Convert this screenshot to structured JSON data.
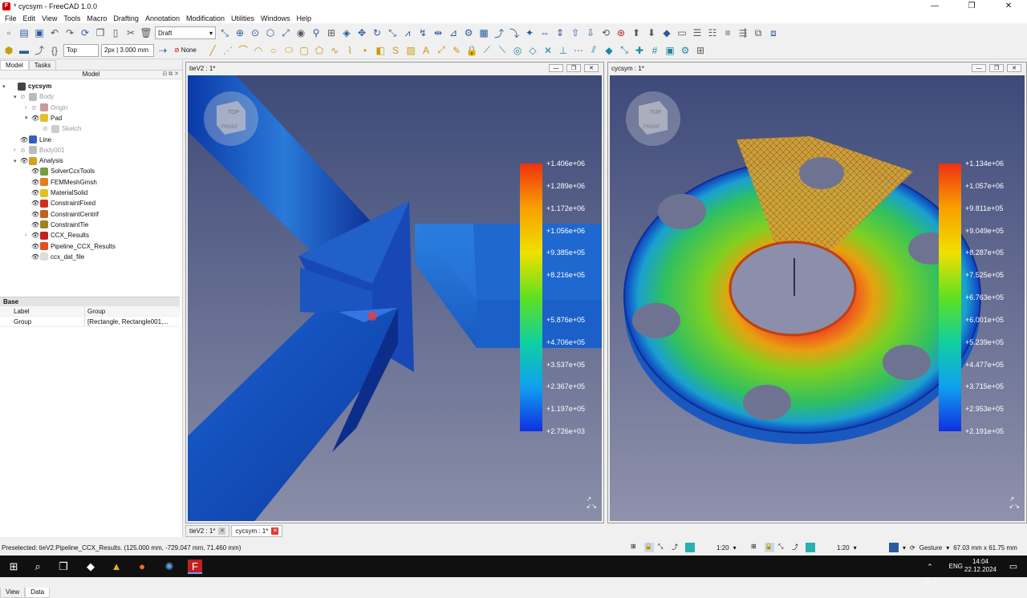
{
  "window": {
    "title": "* cycsym - FreeCAD 1.0.0",
    "controls": [
      "—",
      "❐",
      "✕"
    ]
  },
  "menu": [
    "File",
    "Edit",
    "View",
    "Tools",
    "Macro",
    "Drafting",
    "Annotation",
    "Modification",
    "Utilities",
    "Windows",
    "Help"
  ],
  "toolbar": {
    "workbench": "Draft",
    "view_combo": "Top",
    "style_combo": "2px | 3.000 mm",
    "snap_combo": "None"
  },
  "left_tabs": [
    "Model",
    "Tasks"
  ],
  "tree_header": "Model",
  "tree": [
    {
      "label": "cycsym",
      "level": 0,
      "arrow": "▾",
      "eye": "",
      "icon": "#444",
      "style": "bold"
    },
    {
      "label": "Body",
      "level": 1,
      "arrow": "▾",
      "eye": "◌",
      "icon": "#bbb",
      "style": "dim"
    },
    {
      "label": "Origin",
      "level": 2,
      "arrow": "›",
      "eye": "◌",
      "icon": "#c99",
      "style": "dim"
    },
    {
      "label": "Pad",
      "level": 2,
      "arrow": "▾",
      "eye": "👁",
      "icon": "#e0c030",
      "style": ""
    },
    {
      "label": "Sketch",
      "level": 3,
      "arrow": "",
      "eye": "◌",
      "icon": "#ccc",
      "style": "dim"
    },
    {
      "label": "Line",
      "level": 1,
      "arrow": "",
      "eye": "👁",
      "icon": "#3060c0",
      "style": ""
    },
    {
      "label": "Body001",
      "level": 1,
      "arrow": "›",
      "eye": "◌",
      "icon": "#bbb",
      "style": "dim"
    },
    {
      "label": "Analysis",
      "level": 1,
      "arrow": "▾",
      "eye": "👁",
      "icon": "#d4a020",
      "style": ""
    },
    {
      "label": "SolverCcxTools",
      "level": 2,
      "arrow": "",
      "eye": "👁",
      "icon": "#70a040",
      "style": ""
    },
    {
      "label": "FEMMeshGmsh",
      "level": 2,
      "arrow": "",
      "eye": "👁",
      "icon": "#e08020",
      "style": ""
    },
    {
      "label": "MaterialSolid",
      "level": 2,
      "arrow": "",
      "eye": "👁",
      "icon": "#e0c020",
      "style": ""
    },
    {
      "label": "ConstraintFixed",
      "level": 2,
      "arrow": "",
      "eye": "👁",
      "icon": "#d03020",
      "style": ""
    },
    {
      "label": "ConstraintCentrif",
      "level": 2,
      "arrow": "",
      "eye": "👁",
      "icon": "#c06020",
      "style": ""
    },
    {
      "label": "ConstraintTie",
      "level": 2,
      "arrow": "",
      "eye": "👁",
      "icon": "#a08020",
      "style": ""
    },
    {
      "label": "CCX_Results",
      "level": 2,
      "arrow": "›",
      "eye": "👁",
      "icon": "#c02020",
      "style": ""
    },
    {
      "label": "Pipeline_CCX_Results",
      "level": 2,
      "arrow": "",
      "eye": "👁",
      "icon": "#e05020",
      "style": ""
    },
    {
      "label": "ccx_dat_file",
      "level": 2,
      "arrow": "",
      "eye": "👁",
      "icon": "#ddd",
      "style": ""
    }
  ],
  "props": {
    "section": "Base",
    "col1": "Label",
    "col2": "Group",
    "row_name": "Group",
    "row_value": "[Rectangle, Rectangle001,..."
  },
  "bottom_tabs": [
    "View",
    "Data"
  ],
  "views": [
    {
      "title": "tieV2 : 1*",
      "legend": [
        "+1.406e+06",
        "+1.289e+06",
        "+1.172e+06",
        "+1.056e+06",
        "+9.385e+05",
        "+8.216e+05",
        "",
        "+5.876e+05",
        "+4.706e+05",
        "+3.537e+05",
        "+2.367e+05",
        "+1.197e+05",
        "+2.726e+03"
      ]
    },
    {
      "title": "cycsym : 1*",
      "legend": [
        "+1.134e+06",
        "+1.057e+06",
        "+9.811e+05",
        "+9.049e+05",
        "+8.287e+05",
        "+7.525e+05",
        "+6.763e+05",
        "+6.001e+05",
        "+5.239e+05",
        "+4.477e+05",
        "+3.715e+05",
        "+2.953e+05",
        "+2.191e+05"
      ]
    }
  ],
  "navcube": {
    "top": "TOP",
    "front": "FRONT"
  },
  "doc_tabs": [
    "tieV2 : 1*",
    "cycsym : 1*"
  ],
  "status": {
    "message": "Preselected: tieV2.Pipeline_CCX_Results. (125.000 mm, -729.047 mm, 71.460 mm)",
    "scale1": "1:20",
    "scale2": "1:20",
    "nav": "Gesture",
    "dims": "67.03 mm x 61.75 mm"
  },
  "taskbar": {
    "lang": "ENG",
    "time": "14:04",
    "date": "22.12.2024"
  }
}
